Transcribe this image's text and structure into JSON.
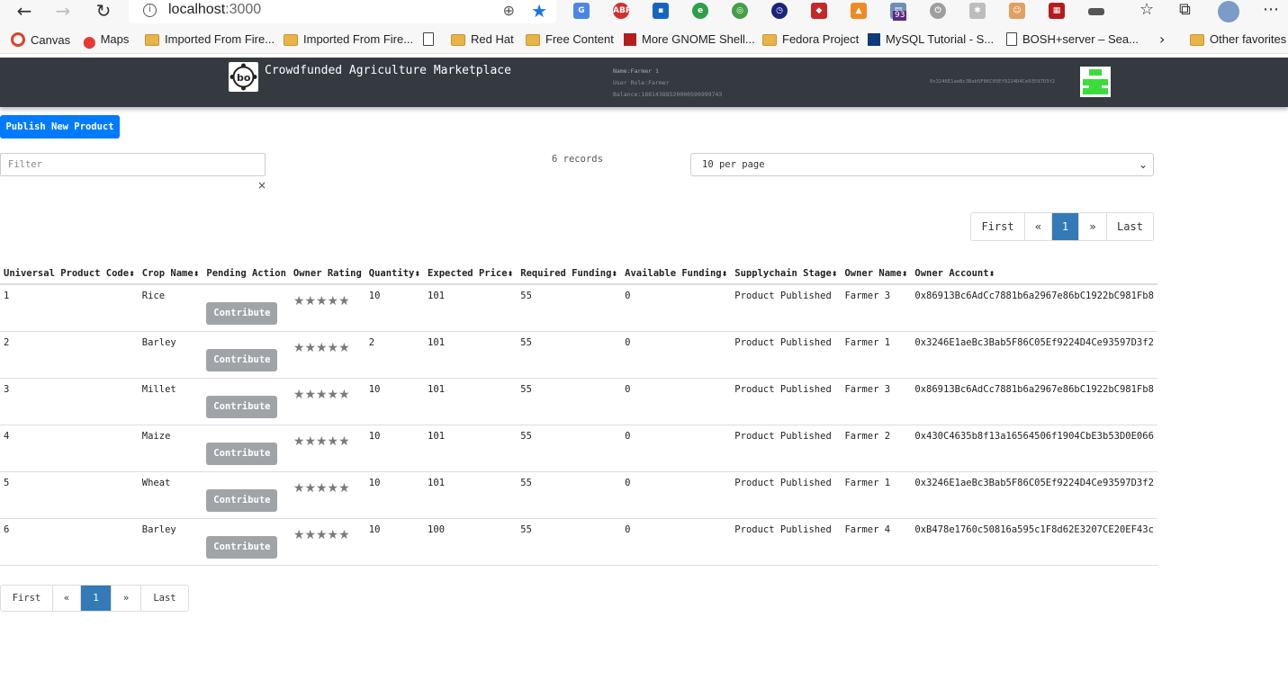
{
  "browser": {
    "url_host": "localhost",
    "url_port": ":3000",
    "bookmarks": [
      {
        "label": "Canvas",
        "icon": "canvas-icon"
      },
      {
        "label": "Maps",
        "icon": "maps-pin-icon"
      },
      {
        "label": "Imported From Fire...",
        "icon": "folder-icon"
      },
      {
        "label": "Imported From Fire...",
        "icon": "folder-icon"
      },
      {
        "label": "",
        "icon": "page-icon"
      },
      {
        "label": "Red Hat",
        "icon": "folder-icon"
      },
      {
        "label": "Free Content",
        "icon": "folder-icon"
      },
      {
        "label": "More GNOME Shell...",
        "icon": "gnome-site-icon"
      },
      {
        "label": "Fedora Project",
        "icon": "folder-icon"
      },
      {
        "label": "MySQL Tutorial - S...",
        "icon": "tutorial-site-icon"
      },
      {
        "label": "BOSH+server – Sea...",
        "icon": "page-icon"
      },
      {
        "label": "Other favorites",
        "icon": "folder-icon"
      }
    ],
    "extension_badge": "93"
  },
  "app": {
    "title": "Crowdfunded Agriculture Marketplace",
    "user_name": "Name:Farmer 1",
    "user_role": "User Role:Farmer",
    "user_balance": "Balance:18814388520000599999743",
    "account_address": "0x3246E1aeBc3Bab5F86C05Ef9224D4Ce93597D3f2"
  },
  "toolbar": {
    "publish_label": "Publish New Product",
    "filter_placeholder": "Filter",
    "filter_clear": "×",
    "records": "6 records",
    "per_page": "10 per page"
  },
  "pagination": {
    "first": "First",
    "prev": "«",
    "current": "1",
    "next": "»",
    "last": "Last"
  },
  "table": {
    "headers": [
      "Universal Product Code",
      "Crop Name",
      "Pending Action",
      "Owner Rating",
      "Quantity",
      "Expected Price",
      "Required Funding",
      "Available Funding",
      "Supplychain Stage",
      "Owner Name",
      "Owner Account"
    ],
    "sortable": [
      true,
      true,
      false,
      false,
      true,
      true,
      true,
      true,
      true,
      true,
      true
    ],
    "action_label": "Contribute",
    "rating_display": "★★★★★",
    "rows": [
      {
        "upc": "1",
        "crop": "Rice",
        "quantity": "10",
        "price": "101",
        "required": "55",
        "available": "0",
        "stage": "Product Published",
        "owner": "Farmer 3",
        "account": "0x86913Bc6AdCc7881b6a2967e86bC1922bC981Fb8"
      },
      {
        "upc": "2",
        "crop": "Barley",
        "quantity": "2",
        "price": "101",
        "required": "55",
        "available": "0",
        "stage": "Product Published",
        "owner": "Farmer 1",
        "account": "0x3246E1aeBc3Bab5F86C05Ef9224D4Ce93597D3f2"
      },
      {
        "upc": "3",
        "crop": "Millet",
        "quantity": "10",
        "price": "101",
        "required": "55",
        "available": "0",
        "stage": "Product Published",
        "owner": "Farmer 3",
        "account": "0x86913Bc6AdCc7881b6a2967e86bC1922bC981Fb8"
      },
      {
        "upc": "4",
        "crop": "Maize",
        "quantity": "10",
        "price": "101",
        "required": "55",
        "available": "0",
        "stage": "Product Published",
        "owner": "Farmer 2",
        "account": "0x430C4635b8f13a16564506f1904CbE3b53D0E066"
      },
      {
        "upc": "5",
        "crop": "Wheat",
        "quantity": "10",
        "price": "101",
        "required": "55",
        "available": "0",
        "stage": "Product Published",
        "owner": "Farmer 1",
        "account": "0x3246E1aeBc3Bab5F86C05Ef9224D4Ce93597D3f2"
      },
      {
        "upc": "6",
        "crop": "Barley",
        "quantity": "10",
        "price": "100",
        "required": "55",
        "available": "0",
        "stage": "Product Published",
        "owner": "Farmer 4",
        "account": "0xB478e1760c50816a595c1F8d62E3207CE20EF43c"
      }
    ]
  }
}
